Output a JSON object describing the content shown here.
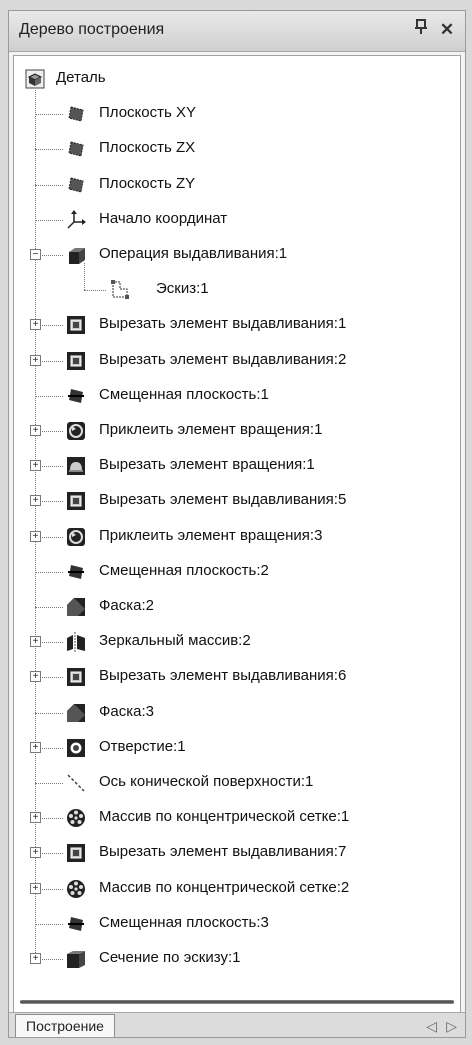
{
  "panel": {
    "title": "Дерево построения",
    "pin_glyph": "ᵩ",
    "close_glyph": "✕"
  },
  "tree": {
    "root": {
      "label": "Деталь",
      "icon": "part-icon"
    },
    "items": [
      {
        "label": "Плоскость XY",
        "icon": "plane-icon",
        "expandable": false
      },
      {
        "label": "Плоскость ZX",
        "icon": "plane-icon",
        "expandable": false
      },
      {
        "label": "Плоскость ZY",
        "icon": "plane-icon",
        "expandable": false
      },
      {
        "label": "Начало координат",
        "icon": "origin-axes-icon",
        "expandable": false
      },
      {
        "label": "Операция выдавливания:1",
        "icon": "extrude-icon",
        "expandable": true,
        "expanded": true
      },
      {
        "label": "Эскиз:1",
        "icon": "sketch-icon",
        "expandable": false,
        "child": true
      },
      {
        "label": "Вырезать элемент выдавливания:1",
        "icon": "cut-extrude-icon",
        "expandable": true
      },
      {
        "label": "Вырезать элемент выдавливания:2",
        "icon": "cut-extrude-icon",
        "expandable": true
      },
      {
        "label": "Смещенная плоскость:1",
        "icon": "offset-plane-icon",
        "expandable": false
      },
      {
        "label": "Приклеить элемент вращения:1",
        "icon": "revolve-icon",
        "expandable": true
      },
      {
        "label": "Вырезать элемент вращения:1",
        "icon": "cut-revolve-icon",
        "expandable": true
      },
      {
        "label": "Вырезать элемент выдавливания:5",
        "icon": "cut-extrude-icon",
        "expandable": true
      },
      {
        "label": "Приклеить элемент вращения:3",
        "icon": "revolve-icon",
        "expandable": true
      },
      {
        "label": "Смещенная плоскость:2",
        "icon": "offset-plane-icon",
        "expandable": false
      },
      {
        "label": "Фаска:2",
        "icon": "chamfer-icon",
        "expandable": false
      },
      {
        "label": "Зеркальный массив:2",
        "icon": "mirror-array-icon",
        "expandable": true
      },
      {
        "label": "Вырезать элемент выдавливания:6",
        "icon": "cut-extrude-icon",
        "expandable": true
      },
      {
        "label": "Фаска:3",
        "icon": "chamfer-icon",
        "expandable": false
      },
      {
        "label": "Отверстие:1",
        "icon": "hole-icon",
        "expandable": true
      },
      {
        "label": "Ось конической поверхности:1",
        "icon": "axis-icon",
        "expandable": false
      },
      {
        "label": "Массив по концентрической сетке:1",
        "icon": "circular-array-icon",
        "expandable": true
      },
      {
        "label": "Вырезать элемент выдавливания:7",
        "icon": "cut-extrude-icon",
        "expandable": true
      },
      {
        "label": "Массив по концентрической сетке:2",
        "icon": "circular-array-icon",
        "expandable": true
      },
      {
        "label": "Смещенная плоскость:3",
        "icon": "offset-plane-icon",
        "expandable": false
      },
      {
        "label": "Сечение по эскизу:1",
        "icon": "section-icon",
        "expandable": true
      }
    ]
  },
  "tabs": {
    "active_label": "Построение",
    "prev_glyph": "◁",
    "next_glyph": "▷"
  },
  "colors": {
    "panel_bg": "#f3f3f3",
    "tree_bg": "#ffffff",
    "icon_dark": "#222222"
  }
}
